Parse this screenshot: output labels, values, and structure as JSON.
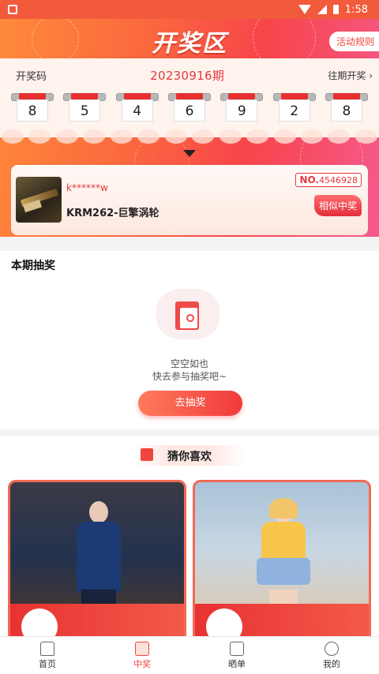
{
  "status_bar": {
    "time": "1:58"
  },
  "header": {
    "title": "开奖区",
    "rules_label": "活动规则"
  },
  "draw_code": {
    "label": "开奖码",
    "period": "20230916期",
    "history_label": "往期开奖",
    "digits": [
      "8",
      "5",
      "4",
      "6",
      "9",
      "2",
      "8"
    ]
  },
  "winner": {
    "user": "k******w",
    "item_name": "KRM262-巨擎涡轮",
    "no_prefix": "NO.",
    "no_value": "4546928",
    "similar_label": "相似中奖"
  },
  "this_draw": {
    "title": "本期抽奖",
    "empty_line1": "空空如也",
    "empty_line2": "快去参与抽奖吧~",
    "go_label": "去抽奖"
  },
  "guess": {
    "title": "猜你喜欢"
  },
  "tabbar": {
    "items": [
      {
        "label": "首页",
        "icon": "home-icon"
      },
      {
        "label": "中奖",
        "icon": "gift-icon"
      },
      {
        "label": "晒单",
        "icon": "chat-icon"
      },
      {
        "label": "我的",
        "icon": "user-icon"
      }
    ],
    "active_index": 1
  },
  "colors": {
    "accent": "#f0453b",
    "header_start": "#ff8a3a",
    "header_end": "#f55a8e"
  }
}
